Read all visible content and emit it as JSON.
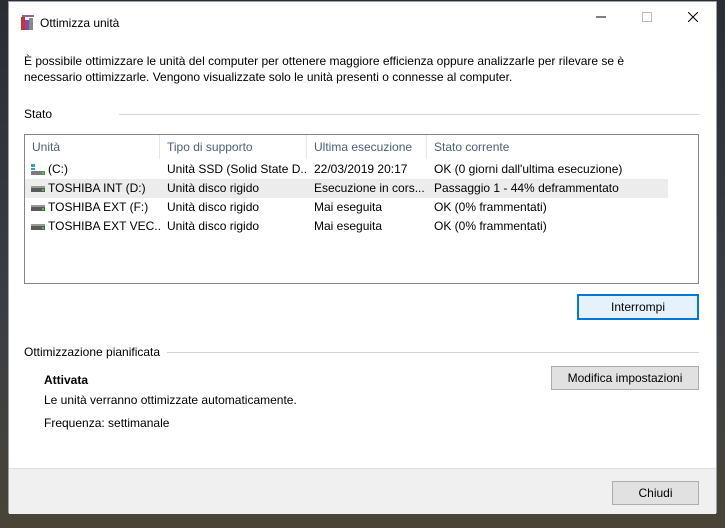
{
  "window": {
    "title": "Ottimizza unità",
    "controls": {
      "minimize": "—",
      "maximize": "☐",
      "close": "✕"
    }
  },
  "intro_text": "È possibile ottimizzare le unità del computer per ottenere maggiore efficienza oppure analizzarle per rilevare se è necessario ottimizzarle. Vengono visualizzate solo le unità presenti o connesse al computer.",
  "status_section": {
    "label": "Stato",
    "columns": [
      "Unità",
      "Tipo di supporto",
      "Ultima esecuzione",
      "Stato corrente"
    ],
    "drives": [
      {
        "name": "(C:)",
        "media": "Unità SSD (Solid State D...",
        "last_run": "22/03/2019 20:17",
        "status": "OK (0 giorni dall'ultima esecuzione)",
        "icon": "ssd-drive-icon"
      },
      {
        "name": "TOSHIBA INT (D:)",
        "media": "Unità disco rigido",
        "last_run": "Esecuzione in cors...",
        "status": "Passaggio 1 - 44% deframmentato",
        "icon": "hard-drive-icon",
        "selected": true
      },
      {
        "name": "TOSHIBA EXT (F:)",
        "media": "Unità disco rigido",
        "last_run": "Mai eseguita",
        "status": "OK (0% frammentati)",
        "icon": "hard-drive-icon"
      },
      {
        "name": "TOSHIBA EXT VEC...",
        "media": "Unità disco rigido",
        "last_run": "Mai eseguita",
        "status": "OK (0% frammentati)",
        "icon": "hard-drive-icon"
      }
    ],
    "stop_button": "Interrompi"
  },
  "scheduled_section": {
    "label": "Ottimizzazione pianificata",
    "state": "Attivata",
    "description": "Le unità verranno ottimizzate automaticamente.",
    "frequency": "Frequenza: settimanale",
    "change_settings_button": "Modifica impostazioni"
  },
  "close_button": "Chiudi",
  "colors": {
    "accent": "#0078d7",
    "header_text": "#4c607a",
    "selected_row": "#ececec",
    "ssd_icon": "#2b9fd9",
    "hdd_icon": "#5a5a5a"
  }
}
